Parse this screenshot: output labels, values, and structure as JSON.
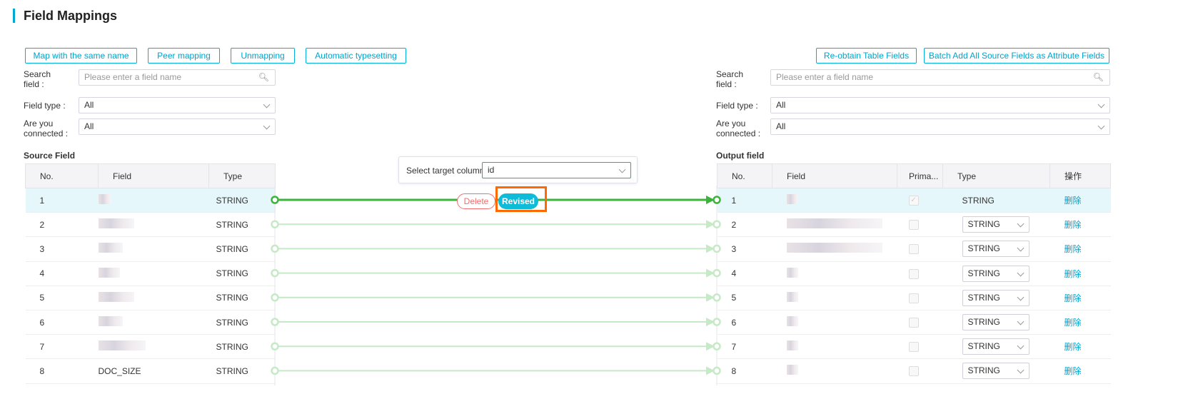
{
  "title": "Field Mappings",
  "toolbar_left": [
    "Map with the same name",
    "Peer mapping",
    "Unmapping",
    "Automatic typesetting"
  ],
  "toolbar_right": [
    "Re-obtain Table Fields",
    "Batch Add All Source Fields as Attribute Fields"
  ],
  "filters": {
    "search_label": "Search field :",
    "search_placeholder": "Please enter a field name",
    "type_label": "Field type :",
    "type_value": "All",
    "connected_label": "Are you connected :",
    "connected_value": "All"
  },
  "source": {
    "title": "Source Field",
    "headers": [
      "No.",
      "Field",
      "Type"
    ],
    "rows": [
      {
        "no": "1",
        "field": "",
        "type": "STRING"
      },
      {
        "no": "2",
        "field": "",
        "type": "STRING"
      },
      {
        "no": "3",
        "field": "",
        "type": "STRING"
      },
      {
        "no": "4",
        "field": "",
        "type": "STRING"
      },
      {
        "no": "5",
        "field": "",
        "type": "STRING"
      },
      {
        "no": "6",
        "field": "",
        "type": "STRING"
      },
      {
        "no": "7",
        "field": "",
        "type": "STRING"
      },
      {
        "no": "8",
        "field": "DOC_SIZE",
        "type": "STRING"
      }
    ]
  },
  "output": {
    "title": "Output field",
    "headers": [
      "No.",
      "Field",
      "Prima...",
      "Type",
      "操作"
    ],
    "action": "删除",
    "rows": [
      {
        "no": "1",
        "type": "STRING"
      },
      {
        "no": "2",
        "type": "STRING"
      },
      {
        "no": "3",
        "type": "STRING"
      },
      {
        "no": "4",
        "type": "STRING"
      },
      {
        "no": "5",
        "type": "STRING"
      },
      {
        "no": "6",
        "type": "STRING"
      },
      {
        "no": "7",
        "type": "STRING"
      },
      {
        "no": "8",
        "type": "STRING"
      }
    ]
  },
  "popup": {
    "label": "Select target column:",
    "value": "id"
  },
  "actions": {
    "delete": "Delete",
    "revised": "Revised"
  },
  "colors": {
    "accent": "#00b0d8",
    "line_active": "#3cb43c",
    "line_idle": "#c6e9c6",
    "highlight": "#ff6a00"
  }
}
